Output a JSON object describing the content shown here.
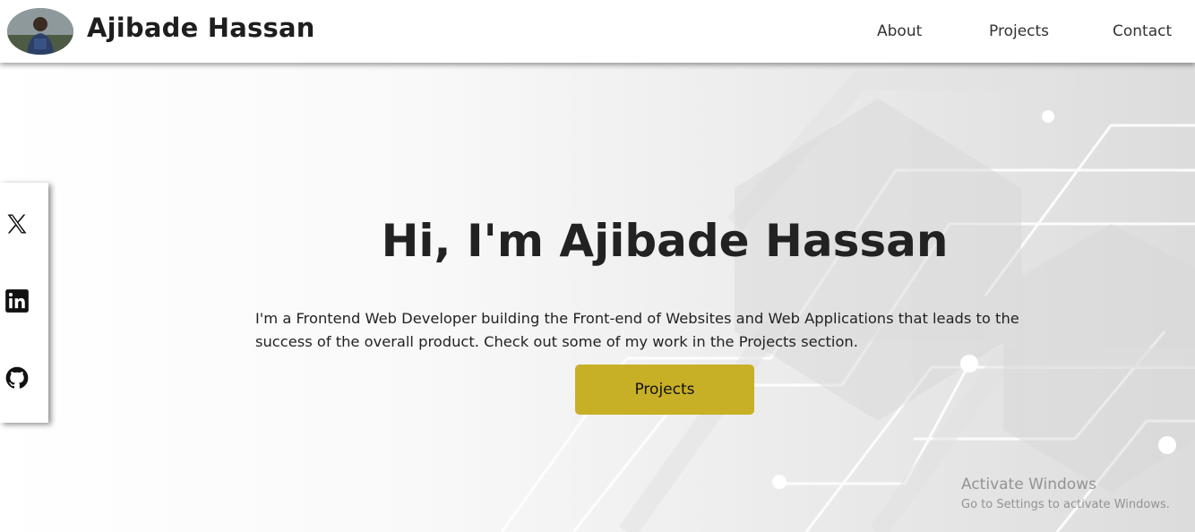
{
  "header": {
    "brand_name": "Ajibade Hassan",
    "nav": [
      {
        "label": "About"
      },
      {
        "label": "Projects"
      },
      {
        "label": "Contact"
      }
    ]
  },
  "social": [
    {
      "icon": "x-twitter-icon"
    },
    {
      "icon": "linkedin-icon"
    },
    {
      "icon": "github-icon"
    }
  ],
  "hero": {
    "title": "Hi, I'm Ajibade Hassan",
    "description": "I'm a Frontend Web Developer building the Front-end of Websites and Web Applications that leads to the success of the overall product. Check out some of my work in the Projects section.",
    "cta_label": "Projects"
  },
  "watermark": {
    "title": "Activate Windows",
    "subtitle": "Go to Settings to activate Windows."
  },
  "colors": {
    "accent": "#c8b026",
    "header_bg": "#ffffff"
  }
}
